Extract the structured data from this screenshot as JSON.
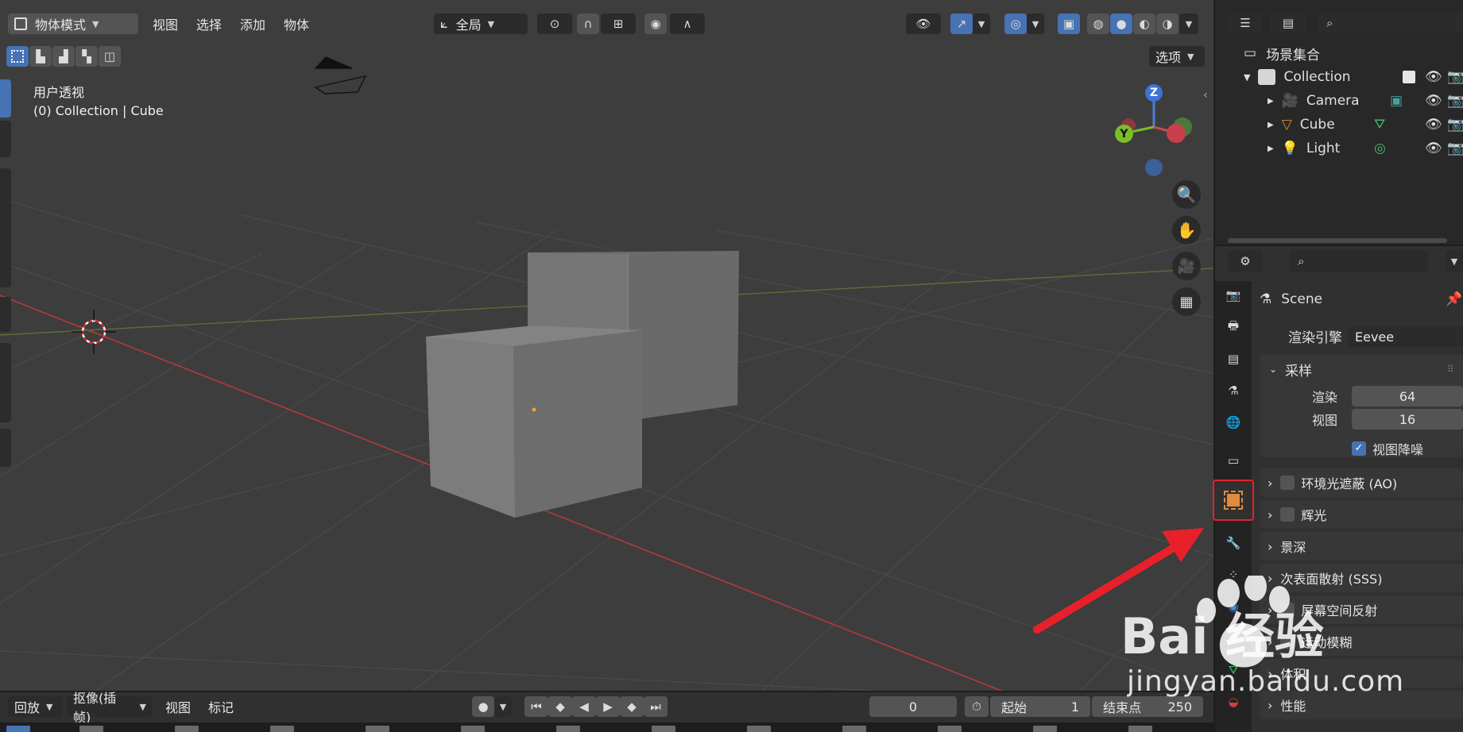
{
  "viewport": {
    "mode_label": "物体模式",
    "menus": [
      "视图",
      "选择",
      "添加",
      "物体"
    ],
    "transform_orientation": "全局",
    "options_label": "选项",
    "view_name": "用户透视",
    "context_line": "(0) Collection | Cube",
    "gizmo_axes": {
      "z": "Z",
      "y": "Y"
    }
  },
  "outliner": {
    "root": "场景集合",
    "collection": "Collection",
    "items": [
      {
        "label": "Camera",
        "icon": "camera-icon"
      },
      {
        "label": "Cube",
        "icon": "mesh-icon"
      },
      {
        "label": "Light",
        "icon": "light-icon"
      }
    ]
  },
  "properties": {
    "scene_name": "Scene",
    "engine_label": "渲染引擎",
    "engine_value": "Eevee",
    "sampling": {
      "title": "采样",
      "render_label": "渲染",
      "render_value": "64",
      "viewport_label": "视图",
      "viewport_value": "16",
      "denoise_label": "视图降噪"
    },
    "panels": [
      {
        "title": "环境光遮蔽 (AO)",
        "checkbox": true
      },
      {
        "title": "辉光",
        "checkbox": true
      },
      {
        "title": "景深",
        "checkbox": false
      },
      {
        "title": "次表面散射 (SSS)",
        "checkbox": false
      },
      {
        "title": "屏幕空间反射",
        "checkbox": true
      },
      {
        "title": "运动模糊",
        "checkbox": true
      },
      {
        "title": "体积",
        "checkbox": false
      },
      {
        "title": "性能",
        "checkbox": false
      }
    ]
  },
  "timeline": {
    "playback": "回放",
    "keying": "抠像(插帧)",
    "view": "视图",
    "marker": "标记",
    "current_frame": "0",
    "start_label": "起始",
    "start_value": "1",
    "end_label": "结束点",
    "end_value": "250"
  },
  "watermark": {
    "brand": "Bai 经验",
    "url": "jingyan.baidu.com"
  },
  "colors": {
    "accent": "#4772b3",
    "highlight_box": "#e0242c",
    "arrow": "#e8202a",
    "object_tab": "#e08a3a"
  }
}
